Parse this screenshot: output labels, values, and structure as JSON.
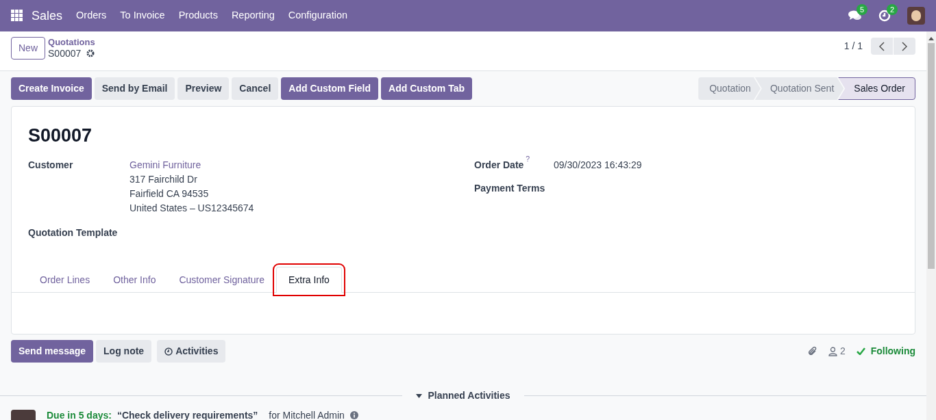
{
  "navbar": {
    "app": "Sales",
    "menu": [
      "Orders",
      "To Invoice",
      "Products",
      "Reporting",
      "Configuration"
    ],
    "messages_count": "5",
    "activities_count": "2"
  },
  "control_panel": {
    "new_button": "New",
    "breadcrumb": "Quotations",
    "record": "S00007",
    "pager": "1 / 1"
  },
  "actions": [
    {
      "label": "Create Invoice",
      "primary": true
    },
    {
      "label": "Send by Email",
      "primary": false
    },
    {
      "label": "Preview",
      "primary": false
    },
    {
      "label": "Cancel",
      "primary": false
    },
    {
      "label": "Add Custom Field",
      "primary": true
    },
    {
      "label": "Add Custom Tab",
      "primary": true
    }
  ],
  "stages": [
    {
      "label": "Quotation",
      "selected": false
    },
    {
      "label": "Quotation Sent",
      "selected": false
    },
    {
      "label": "Sales Order",
      "selected": true
    }
  ],
  "form": {
    "title": "S00007",
    "customer": {
      "label": "Customer",
      "name": "Gemini Furniture",
      "address": [
        "317 Fairchild Dr",
        "Fairfield CA 94535",
        "United States – US12345674"
      ]
    },
    "order_date": {
      "label": "Order Date",
      "help": "?",
      "value": "09/30/2023 16:43:29"
    },
    "payment_terms": {
      "label": "Payment Terms"
    },
    "quotation_template": {
      "label": "Quotation Template"
    },
    "tabs": [
      {
        "label": "Order Lines",
        "selected": false,
        "highlighted": false
      },
      {
        "label": "Other Info",
        "selected": false,
        "highlighted": false
      },
      {
        "label": "Customer Signature",
        "selected": false,
        "highlighted": false
      },
      {
        "label": "Extra Info",
        "selected": true,
        "highlighted": true
      }
    ]
  },
  "chatter": {
    "buttons": [
      {
        "label": "Send message",
        "primary": true
      },
      {
        "label": "Log note",
        "primary": false
      },
      {
        "label": "Activities",
        "primary": false
      }
    ],
    "followers_count": "2",
    "following": "Following",
    "section": "Planned Activities",
    "activity": {
      "due": "Due in 5 days:",
      "summary": "“Check delivery requirements”",
      "assignee": "for Mitchell Admin"
    }
  }
}
